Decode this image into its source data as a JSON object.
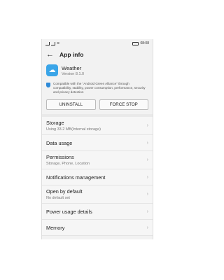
{
  "statusbar": {
    "time": "08:08"
  },
  "header": {
    "title": "App info"
  },
  "app": {
    "name": "Weather",
    "version": "Version 8.1.0"
  },
  "green_alliance": {
    "text": "Compatible with the \"Android Green Alliance\" through compatibility, stability, power consumption, performance, security and privacy detection"
  },
  "buttons": {
    "uninstall": "UNINSTALL",
    "force_stop": "FORCE STOP"
  },
  "settings": [
    {
      "title": "Storage",
      "subtitle": "Using 33.2 MB(Internal storage)"
    },
    {
      "title": "Data usage"
    },
    {
      "title": "Permissions",
      "subtitle": "Storage, Phone, Location"
    },
    {
      "title": "Notifications management"
    },
    {
      "title": "Open by default",
      "subtitle": "No default set"
    },
    {
      "title": "Power usage details"
    },
    {
      "title": "Memory"
    }
  ],
  "colors": {
    "app_icon": "#3aa5e8",
    "shield": "#2e8ad8"
  }
}
